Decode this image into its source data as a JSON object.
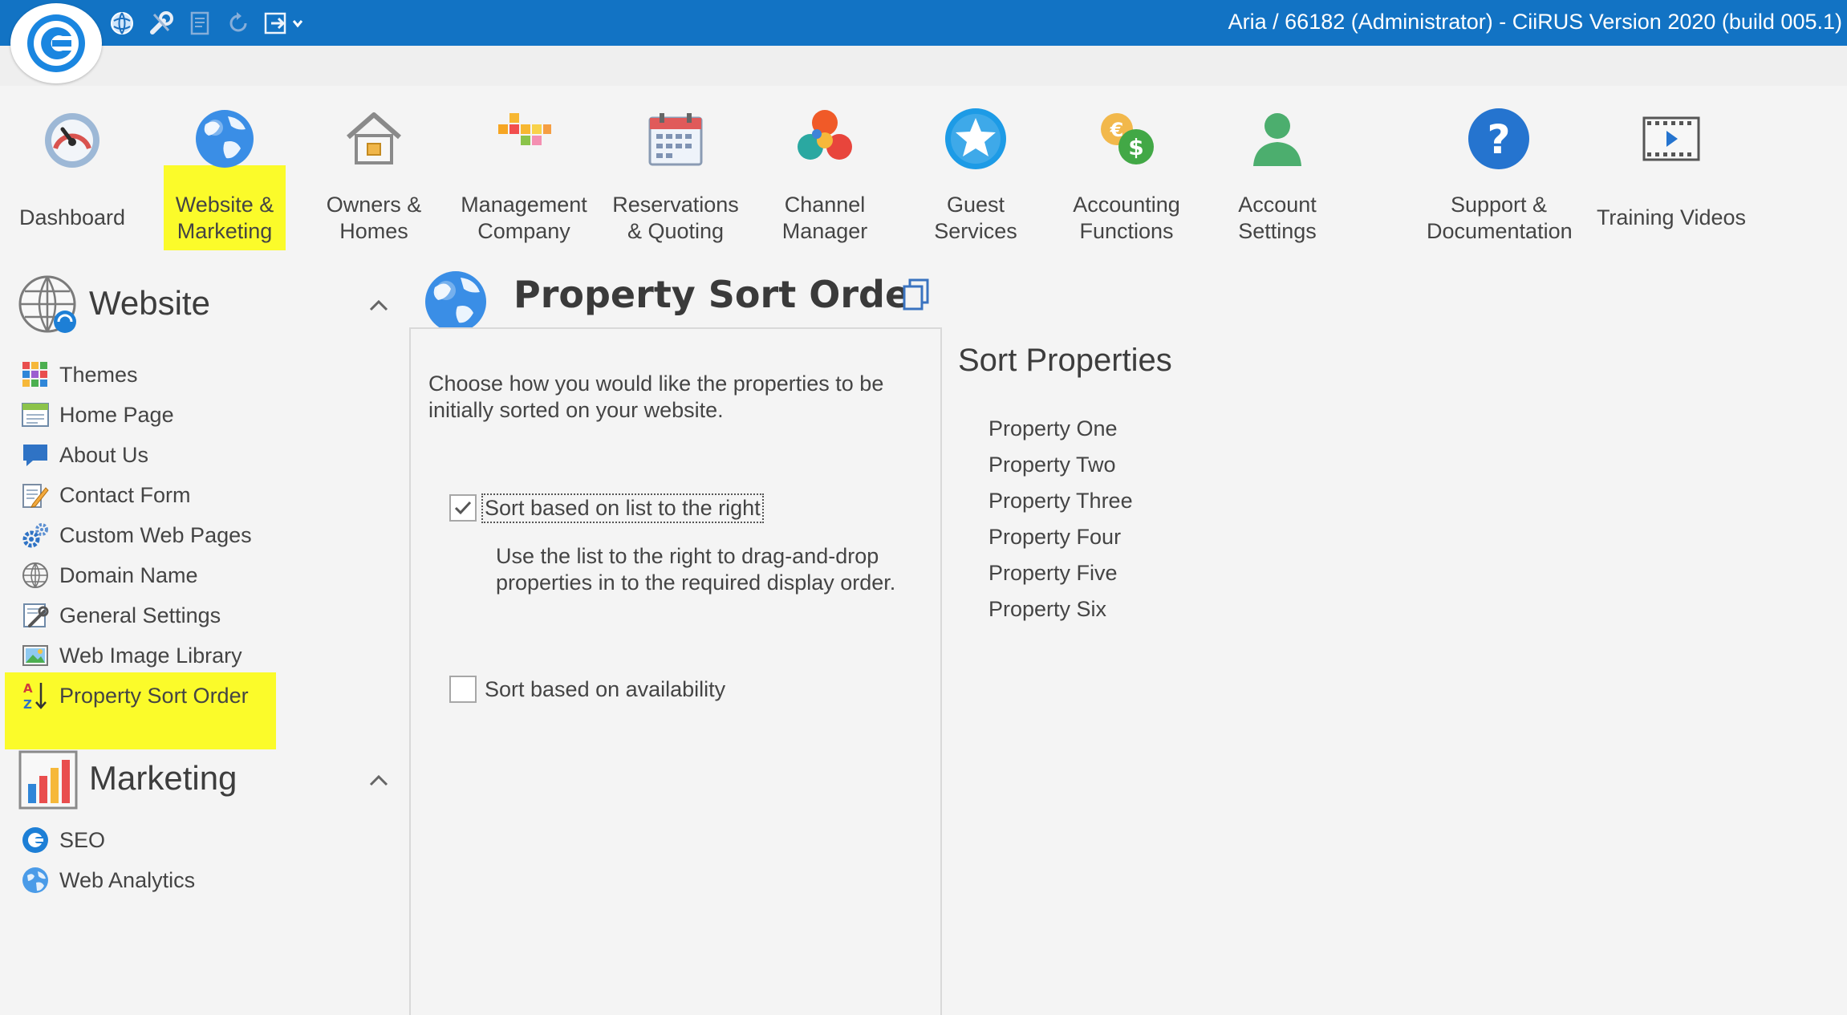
{
  "window": {
    "title": "Aria / 66182 (Administrator) - CiiRUS Version 2020 (build 005.1)"
  },
  "quick_access": [
    {
      "icon": "globe-sync-icon"
    },
    {
      "icon": "tools-icon"
    },
    {
      "icon": "document-icon"
    },
    {
      "icon": "refresh-icon"
    },
    {
      "icon": "export-icon"
    }
  ],
  "ribbon": {
    "items": [
      {
        "id": "dashboard",
        "lines": [
          "Dashboard"
        ],
        "icon": "gauge-icon"
      },
      {
        "id": "website-marketing",
        "lines": [
          "Website &",
          "Marketing"
        ],
        "icon": "globe-icon",
        "highlighted": true
      },
      {
        "id": "owners-homes",
        "lines": [
          "Owners &",
          "Homes"
        ],
        "icon": "house-icon"
      },
      {
        "id": "management-company",
        "lines": [
          "Management",
          "Company"
        ],
        "icon": "blocks-icon"
      },
      {
        "id": "reservations-quoting",
        "lines": [
          "Reservations",
          "& Quoting"
        ],
        "icon": "calendar-icon"
      },
      {
        "id": "channel-manager",
        "lines": [
          "Channel",
          "Manager"
        ],
        "icon": "channel-icon"
      },
      {
        "id": "guest-services",
        "lines": [
          "Guest",
          "Services"
        ],
        "icon": "star-icon"
      },
      {
        "id": "accounting-functions",
        "lines": [
          "Accounting",
          "Functions"
        ],
        "icon": "coins-icon"
      },
      {
        "id": "account-settings",
        "lines": [
          "Account",
          "Settings"
        ],
        "icon": "user-icon"
      },
      {
        "id": "support-documentation",
        "lines": [
          "Support &",
          "Documentation"
        ],
        "icon": "help-icon"
      },
      {
        "id": "training-videos",
        "lines": [
          "Training Videos"
        ],
        "icon": "film-icon"
      }
    ]
  },
  "nav": {
    "website": {
      "title": "Website",
      "items": [
        {
          "label": "Themes",
          "icon": "themes-icon"
        },
        {
          "label": "Home Page",
          "icon": "home-page-icon"
        },
        {
          "label": "About Us",
          "icon": "about-us-icon"
        },
        {
          "label": "Contact Form",
          "icon": "contact-form-icon"
        },
        {
          "label": "Custom Web Pages",
          "icon": "gears-icon"
        },
        {
          "label": "Domain Name",
          "icon": "domain-globe-icon"
        },
        {
          "label": "General Settings",
          "icon": "settings-icon"
        },
        {
          "label": "Web Image Library",
          "icon": "image-library-icon"
        },
        {
          "label": "Property Sort Order",
          "icon": "sort-az-icon",
          "highlighted": true
        }
      ]
    },
    "marketing": {
      "title": "Marketing",
      "items": [
        {
          "label": "SEO",
          "icon": "seo-icon"
        },
        {
          "label": "Web Analytics",
          "icon": "analytics-globe-icon"
        }
      ]
    }
  },
  "page": {
    "title": "Property Sort Order",
    "intro": "Choose how you would like the properties to be initially sorted on your website.",
    "options": {
      "sort_list": {
        "label": "Sort based on list to the right",
        "checked": true,
        "description": "Use the list to the right to drag-and-drop properties in to the required display order."
      },
      "sort_availability": {
        "label": "Sort based on availability",
        "checked": false
      }
    }
  },
  "sort_properties": {
    "title": "Sort Properties",
    "items": [
      "Property One",
      "Property Two",
      "Property Three",
      "Property Four",
      "Property Five",
      "Property Six"
    ]
  },
  "colors": {
    "titlebar": "#1273c4",
    "highlight": "#fbfb2a",
    "background": "#f4f4f4"
  }
}
